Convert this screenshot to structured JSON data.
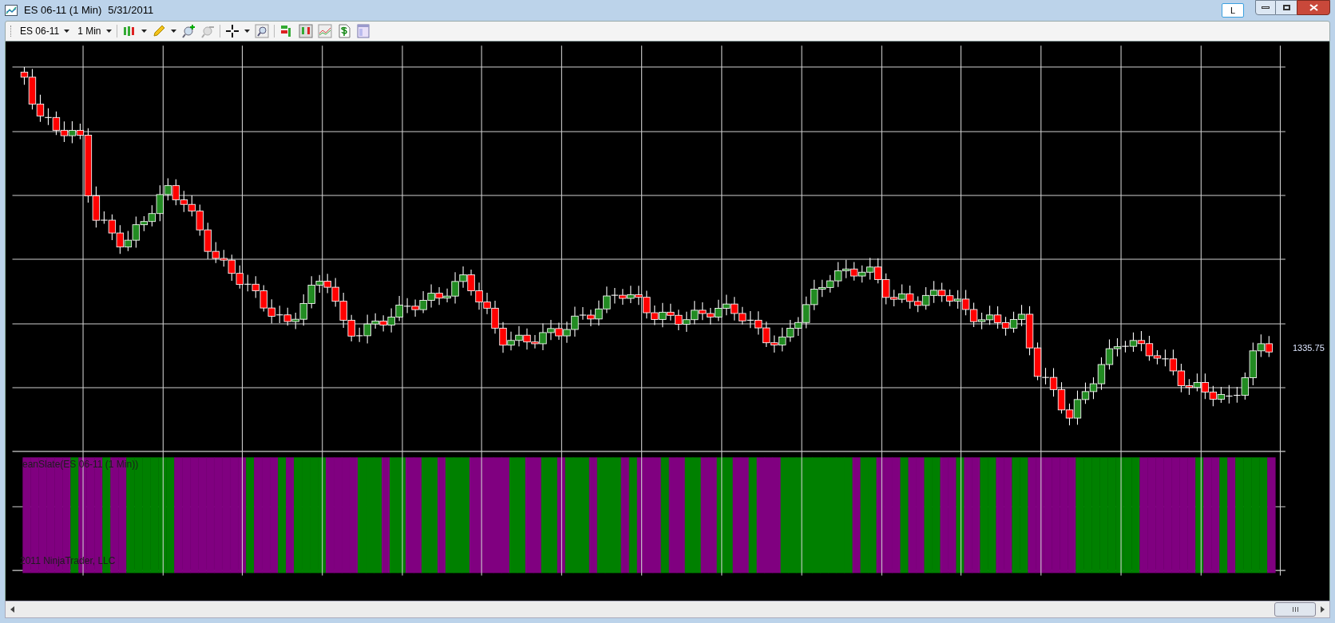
{
  "window": {
    "title": "ES 06-11 (1 Min)",
    "date": "5/31/2011",
    "link_button": "L"
  },
  "toolbar": {
    "instrument": "ES 06-11",
    "interval": "1 Min"
  },
  "chart": {
    "last_price": "1335.75",
    "indicator_label": "eanSlate(ES 06-11 (1 Min))",
    "copyright": "2011 NinjaTrader, LLC"
  }
}
